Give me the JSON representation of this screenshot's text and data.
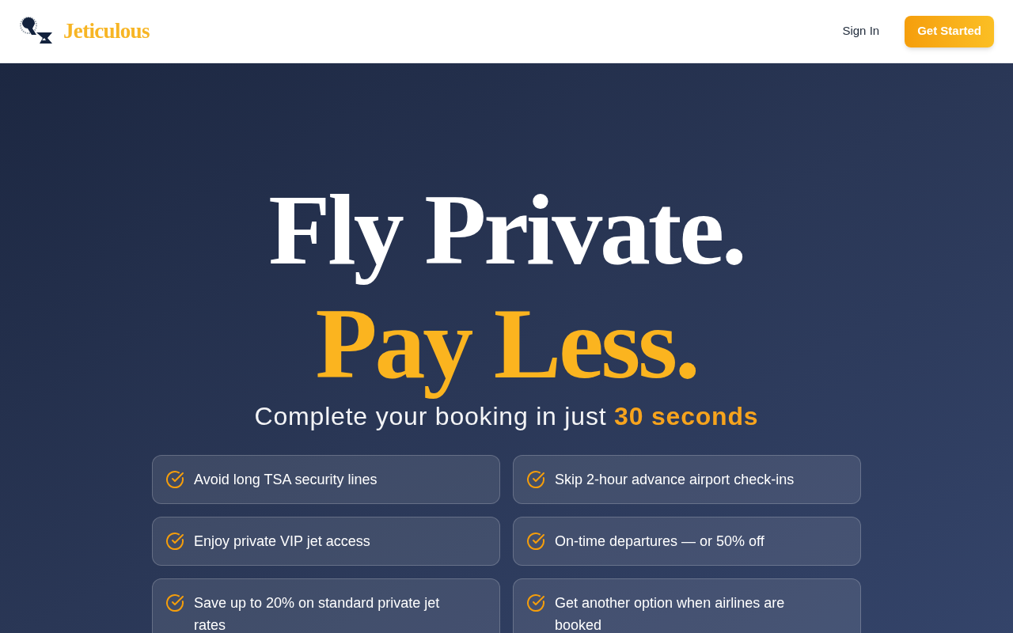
{
  "header": {
    "brand": "Jeticulous",
    "sign_in": "Sign In",
    "cta": "Get Started"
  },
  "hero": {
    "headline_line_1": "Fly Private.",
    "headline_line_2": "Pay Less.",
    "subtitle": "Complete your booking in just **30 seconds**",
    "features": [
      "Avoid long TSA security lines",
      "Skip 2-hour advance airport check-ins",
      "Enjoy private VIP jet access",
      "On-time departures — or 50% off",
      "Save up to 20% on standard private jet rates",
      "Get another option when airlines are booked"
    ]
  }
}
